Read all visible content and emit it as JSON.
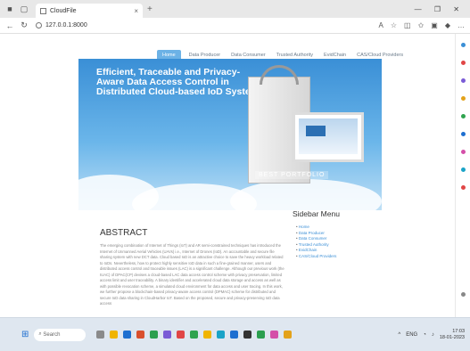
{
  "browser": {
    "tab_title": "CloudFile",
    "url": "127.0.0.1:8000",
    "nav_back": "←",
    "nav_reload": "↻",
    "tab_close": "×",
    "new_tab": "+",
    "window_controls": "— ❐ ✕"
  },
  "page": {
    "nav": [
      {
        "label": "Home",
        "active": true
      },
      {
        "label": "Data Producer"
      },
      {
        "label": "Data Consumer"
      },
      {
        "label": "Trusted Authority"
      },
      {
        "label": "EvidChain"
      },
      {
        "label": "CAS/Cloud Providers"
      }
    ],
    "hero_title": "Efficient, Traceable and Privacy-Aware Data Access Control in Distributed Cloud-based IoD Systems",
    "hero_banner": "BEST PORTFOLIO",
    "abstract_heading": "ABSTRACT",
    "abstract_text": "The emerging combination of Internet of Things (IoT) and AR semi-constrained techniques has introduced the Internet of Unmanned Aerial Vehicles (UAVs) i.e., Internet of Drones (IoD). An accountable and secure file sharing system with new DCT data. Cloud based IoD is an attractive choice to save the heavy workload related to IoDs. Nevertheless, how to protect highly sensitive IoD data in such a fine-grained manner, users and distributed access control and traceable issues (LAC) is a significant challenge. Although our previous work (the IUAC) of DPAC(CP) devises a cloud-based LAC data access control scheme with privacy preservation, limited access limit and user traceability. A binary identifier and accelerated cloud data storage and access as well as with possible revocation scheme, a simulated cloud environment for data access and user tracing. In this work, we further propose a blockchain-based privacy-aware access control (DPMAC) scheme for distributed and secure IoD data sharing in CloudHarbor IoT. Based on the proposed, secure and privacy-preserving IoD data access",
    "sidebar_heading": "Sidebar Menu",
    "sidebar_items": [
      "Home",
      "Data Producer",
      "Data Consumer",
      "Trusted Authority",
      "EvidChain",
      "CAS/Cloud Providers"
    ]
  },
  "taskbar": {
    "search_placeholder": "Search",
    "time": "17:03",
    "date": "18-01-2023",
    "lang": "ENG"
  },
  "colors": {
    "accent": "#6cb2e6",
    "link": "#3b8fd6",
    "hero_top": "#3a8fd6"
  }
}
